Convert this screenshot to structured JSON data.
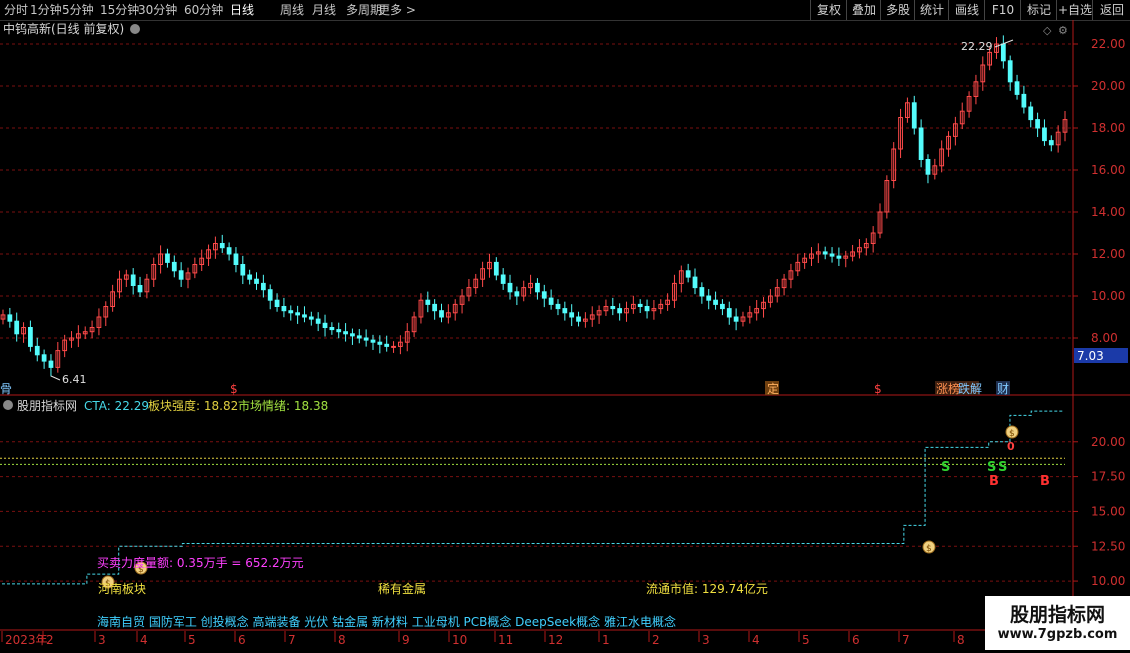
{
  "toolbar": {
    "timeframes": [
      "分时",
      "1分钟",
      "5分钟",
      "15分钟",
      "30分钟",
      "60分钟",
      "日线",
      "周线",
      "月线",
      "多周期",
      "更多 >"
    ],
    "active_index": 6,
    "right_buttons": [
      "复权",
      "叠加",
      "多股",
      "统计",
      "画线",
      "F10",
      "标记",
      "+自选",
      "返回"
    ]
  },
  "header": {
    "title": "中钨高新(日线 前复权)"
  },
  "price_chart": {
    "yticks": [
      "22.00",
      "20.00",
      "18.00",
      "16.00",
      "14.00",
      "12.00",
      "10.00",
      "8.00"
    ],
    "current_price": "7.03",
    "high_label": "22.29",
    "low_label": "6.41",
    "event_markers": [
      "$",
      "$",
      "定",
      "$",
      "涨榜",
      "跌解",
      "财"
    ]
  },
  "indicator": {
    "name": "股朋指标网",
    "cta_label": "CTA: 22.29",
    "sector_strength": "板块强度: 18.82",
    "market_sentiment": "市场情绪: 18.38",
    "yticks": [
      "20.00",
      "17.50",
      "15.00",
      "12.50",
      "10.00"
    ],
    "buy_sell_text": "买卖力度量额: 0.35万手 = 652.2万元",
    "sector_label": "河南板块",
    "rare_metal_label": "稀有金属",
    "market_cap_label": "流通市值: 129.74亿元",
    "concepts": "海南自贸 国防军工 创投概念 高端装备 光伏 钴金属 新材料 工业母机 PCB概念 DeepSeek概念 雅江水电概念",
    "signal_S": "S",
    "signal_B": "B",
    "signal_zero": "0",
    "bag_symbol": "$"
  },
  "time_axis": {
    "labels": [
      "2023年",
      "2",
      "3",
      "4",
      "5",
      "6",
      "7",
      "8",
      "9",
      "10",
      "11",
      "12",
      "1",
      "2",
      "3",
      "4",
      "5",
      "6",
      "7",
      "8"
    ]
  },
  "watermark": {
    "title": "股朋指标网",
    "url": "www.7gpzb.com"
  },
  "colors": {
    "up": "#ff4a4a",
    "down": "#54fcfc",
    "grid": "#7a1010",
    "axis": "#b01818",
    "cta_line": "#46d8e8",
    "sentiment_line": "#a0e040",
    "strength_line": "#e0d040",
    "magenta": "#ff40ff",
    "green": "#30d030",
    "yellow": "#f0e040"
  },
  "chart_data": {
    "type": "candlestick",
    "price_ylim": [
      6,
      23
    ],
    "candles_close": [
      9.1,
      8.8,
      8.2,
      8.5,
      7.6,
      7.2,
      6.9,
      6.6,
      7.4,
      7.9,
      8.0,
      8.2,
      8.3,
      8.5,
      9.0,
      9.5,
      10.2,
      10.8,
      11.0,
      10.5,
      10.2,
      10.8,
      11.5,
      12.0,
      11.6,
      11.2,
      10.8,
      11.1,
      11.5,
      11.8,
      12.2,
      12.5,
      12.3,
      12.0,
      11.5,
      11.0,
      10.8,
      10.6,
      10.3,
      9.8,
      9.5,
      9.3,
      9.2,
      9.1,
      9.0,
      8.9,
      8.7,
      8.5,
      8.4,
      8.3,
      8.2,
      8.1,
      8.0,
      7.9,
      7.8,
      7.7,
      7.6,
      7.6,
      7.8,
      8.3,
      9.0,
      9.8,
      9.6,
      9.3,
      9.0,
      9.2,
      9.6,
      10.0,
      10.4,
      10.8,
      11.3,
      11.6,
      11.0,
      10.6,
      10.2,
      10.0,
      10.4,
      10.6,
      10.2,
      9.9,
      9.6,
      9.4,
      9.2,
      9.0,
      8.8,
      8.9,
      9.1,
      9.3,
      9.5,
      9.4,
      9.2,
      9.4,
      9.6,
      9.5,
      9.3,
      9.4,
      9.6,
      9.8,
      10.6,
      11.2,
      10.9,
      10.4,
      10.0,
      9.8,
      9.6,
      9.4,
      9.0,
      8.8,
      9.0,
      9.2,
      9.4,
      9.7,
      10.0,
      10.4,
      10.8,
      11.2,
      11.6,
      11.8,
      12.0,
      12.1,
      12.0,
      11.9,
      11.8,
      11.9,
      12.1,
      12.3,
      12.5,
      13.0,
      14.0,
      15.5,
      17.0,
      18.5,
      19.2,
      18.0,
      16.5,
      15.8,
      16.2,
      17.0,
      17.6,
      18.2,
      18.8,
      19.5,
      20.2,
      21.0,
      21.6,
      22.0,
      21.2,
      20.2,
      19.6,
      19.0,
      18.4,
      18.0,
      17.4,
      17.2,
      17.8,
      18.4
    ],
    "indicator_ylim": [
      9,
      23
    ],
    "cta_steps": [
      [
        0,
        9.8
      ],
      [
        0.08,
        10.5
      ],
      [
        0.11,
        12.5
      ],
      [
        0.17,
        12.7
      ],
      [
        0.82,
        12.7
      ],
      [
        0.85,
        14.0
      ],
      [
        0.87,
        19.6
      ],
      [
        0.93,
        20.0
      ],
      [
        0.95,
        21.9
      ],
      [
        0.97,
        22.2
      ]
    ],
    "sector_strength": 18.82,
    "market_sentiment": 18.38
  }
}
